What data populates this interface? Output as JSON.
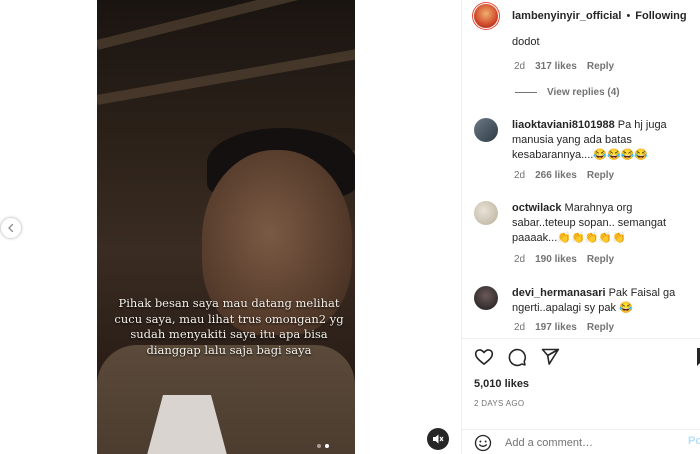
{
  "post": {
    "username": "lambenyinyir_official",
    "separator": "•",
    "follow_status": "Following",
    "caption_overlay": "Pihak besan saya mau datang melihat cucu saya, mau lihat trus omongan2 yg sudah menyakiti saya itu apa bisa dianggap lalu saja bagi saya",
    "likes": "5,010 likes",
    "date": "2 DAYS AGO"
  },
  "comments": [
    {
      "username": "",
      "text": "dodot",
      "age": "2d",
      "likes": "317 likes",
      "reply_label": "Reply",
      "view_replies": "View replies (4)"
    },
    {
      "username": "liaoktaviani8101988",
      "text": "Pa hj juga manusia yang ada batas kesabarannya....😂😂😂😂",
      "age": "2d",
      "likes": "266 likes",
      "reply_label": "Reply"
    },
    {
      "username": "octwilack",
      "text": "Marahnya org sabar..teteup sopan.. semangat paaaak...👏👏👏👏👏",
      "age": "2d",
      "likes": "190 likes",
      "reply_label": "Reply"
    },
    {
      "username": "devi_hermanasari",
      "text": "Pak Faisal ga ngerti..apalagi sy pak 😂",
      "age": "2d",
      "likes": "197 likes",
      "reply_label": "Reply"
    }
  ],
  "comment_box": {
    "placeholder": "Add a comment…",
    "post_label": "Po"
  },
  "icons": {
    "like": "heart-icon",
    "comment": "comment-bubble-icon",
    "share": "paper-plane-icon",
    "save": "bookmark-icon",
    "emoji": "smiley-icon",
    "mute": "speaker-muted-icon",
    "prev": "chevron-left-icon"
  },
  "colors": {
    "text": "#262626",
    "muted": "#737373",
    "post_button": "#b2dffc"
  }
}
